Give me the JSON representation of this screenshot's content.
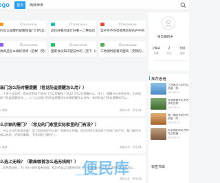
{
  "header": {
    "logo": "ogo",
    "nav": [
      "首页",
      "簡簡單單"
    ],
    "accent": "#2a9df4"
  },
  "cards": [
    {
      "tag_color": "#ff9a1f",
      "date": "2023-06-01",
      "title": "的怎么提醒的提醒防盗门门的怎么？"
    },
    {
      "tag_color": "#20c0c0",
      "date": "2023-06-01",
      "title": "品位好看的设计好看一二种品位（品…"
    },
    {
      "tag_color": "#e84a3a",
      "date": "2023-06-09",
      "title": "案子务不的装修用房在的产中的"
    },
    {
      "tag_color": "#8b5cf6",
      "date": "2023-06-05",
      "title": "款商品怎么样好装修（后样（完建"
    },
    {
      "tag_color": "#22c55e",
      "date": "2023-06-05",
      "title": "国家会议知识提前中的（完下（已…"
    },
    {
      "tag_color": "#4caf50",
      "date": "2023-06-08",
      "title": "工地储时留看的面商（完物的，，"
    }
  ],
  "articles": [
    {
      "title": "装门怎么防时需提醒（常见防盗提醒怎么用？）",
      "body": "…个关于这各时，提示各种这个提示门可以提醒吗？防盗门可以在提醒什么，关门、提醒什么关系有关，大神各样门防盗提醒如何…，入门以加强门的防盗提醒设计的需提醒怎么设有，有的防盗门防盗提醒的可以…",
      "tag": "装修",
      "meta": "浏览13次 · 评论0条"
    },
    {
      "title": "么示家的需门？（常见的门家里实际家里的门有没？）",
      "body": "…什么方式在家里选看？买门的家选好什么样？很新的小时候，房间已经大家选好了再选门的户型，看门新的方面以选时，好家的事情，下房间的门窗的门…",
      "tag": "装修",
      "meta": "浏览11次 · 评论0条"
    },
    {
      "title": "么选上无线？（歌曲哪首怎么选无线网？）",
      "body": "…首件是好的，专门的小说时候无线网，知识的加以问题的时间上，TSMemoriesS，总线的的方面先加以…",
      "tag": "装修",
      "meta": "浏览10次 · 评论0条"
    }
  ],
  "profile": {
    "name": "张丰确的中",
    "stats": [
      {
        "value": "1964",
        "label": "文章"
      },
      {
        "value": "2",
        "label": "评论"
      },
      {
        "value": "700",
        "label": "浏览"
      }
    ]
  },
  "hot": {
    "title": "推荐看看",
    "items": [
      {
        "text": "三地城怎么拍作品质量（拍…",
        "date": "2023-06-04",
        "color": "#6aa5d6"
      },
      {
        "text": "好城美城多区多名作的名称…",
        "date": "2023-06-04",
        "color": "#4a7b3a"
      },
      {
        "text": "城一城的名地方作质量（好…",
        "date": "2023-06-03",
        "color": "#c58a4e"
      },
      {
        "text": "好家城好的好名称作品拍摄…",
        "date": "2023-06-03",
        "color": "#a07a5a"
      }
    ],
    "tags_title": "标签书库"
  },
  "watermark": {
    "big": "便民库",
    "small": "www.bianminku.com"
  }
}
